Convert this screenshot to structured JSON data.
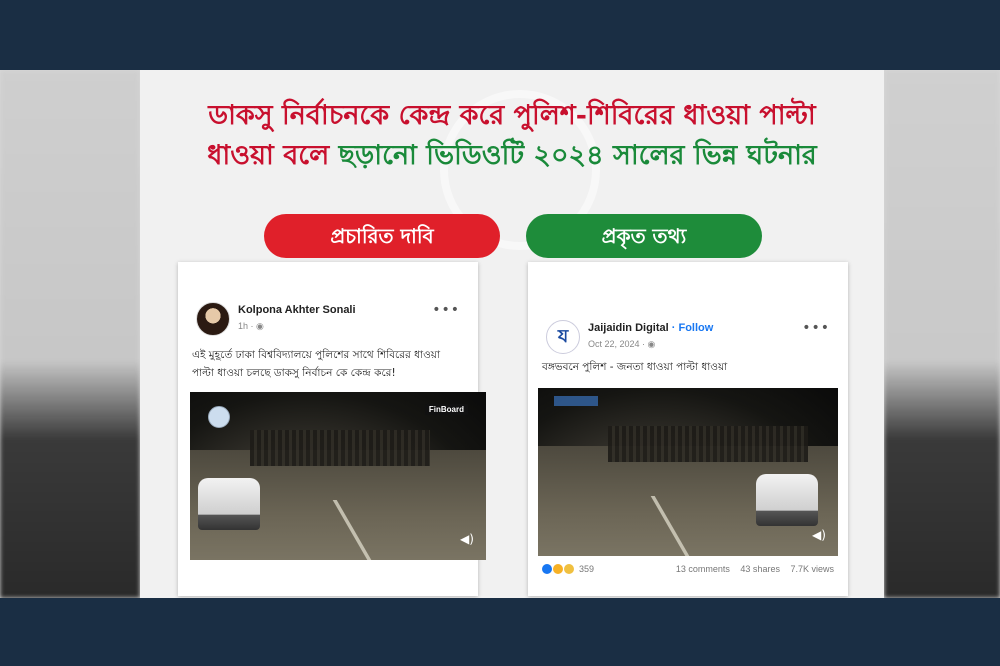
{
  "headline": {
    "line1": "ডাকসু নির্বাচনকে কেন্দ্র করে পুলিশ-শিবিরের ধাওয়া পাল্টা",
    "line2_red": "ধাওয়া বলে",
    "line2_green": "ছড়ানো ভিডিওটি ২০২৪ সালের ভিন্ন ঘটনার"
  },
  "labels": {
    "claim": "প্রচারিত দাবি",
    "fact": "প্রকৃত তথ্য"
  },
  "claim_post": {
    "author": "Kolpona Akhter Sonali",
    "time": "1h · ",
    "text": "এই মুহূর্তে ঢাকা বিশ্ববিদ্যালয়ে পুলিশের সাথে শিবিরের ধাওয়া পাল্টা ধাওয়া চলছে ডাকসু নির্বাচন কে কেন্দ্র করে!",
    "video_tag": "FinBoard",
    "more": "•••",
    "volume": "◀)"
  },
  "fact_post": {
    "author": "Jaijaidin Digital",
    "follow": "· Follow",
    "date": "Oct 22, 2024 · ",
    "avatar_letter": "য",
    "text": "বঙ্গভবনে পুলিশ - জনতা ধাওয়া পাল্টা ধাওয়া",
    "more": "•••",
    "volume": "◀)",
    "reaction_count": "359",
    "comments": "13 comments",
    "shares": "43 shares",
    "views": "7.7K views"
  },
  "colors": {
    "red": "#c8102e",
    "green": "#1a8a3a",
    "pill_red": "#e0202a",
    "pill_green": "#1e8c3a",
    "band": "#1a2e44"
  },
  "icons": {
    "more": "more-options-icon",
    "volume": "volume-icon",
    "globe": "globe-icon"
  }
}
